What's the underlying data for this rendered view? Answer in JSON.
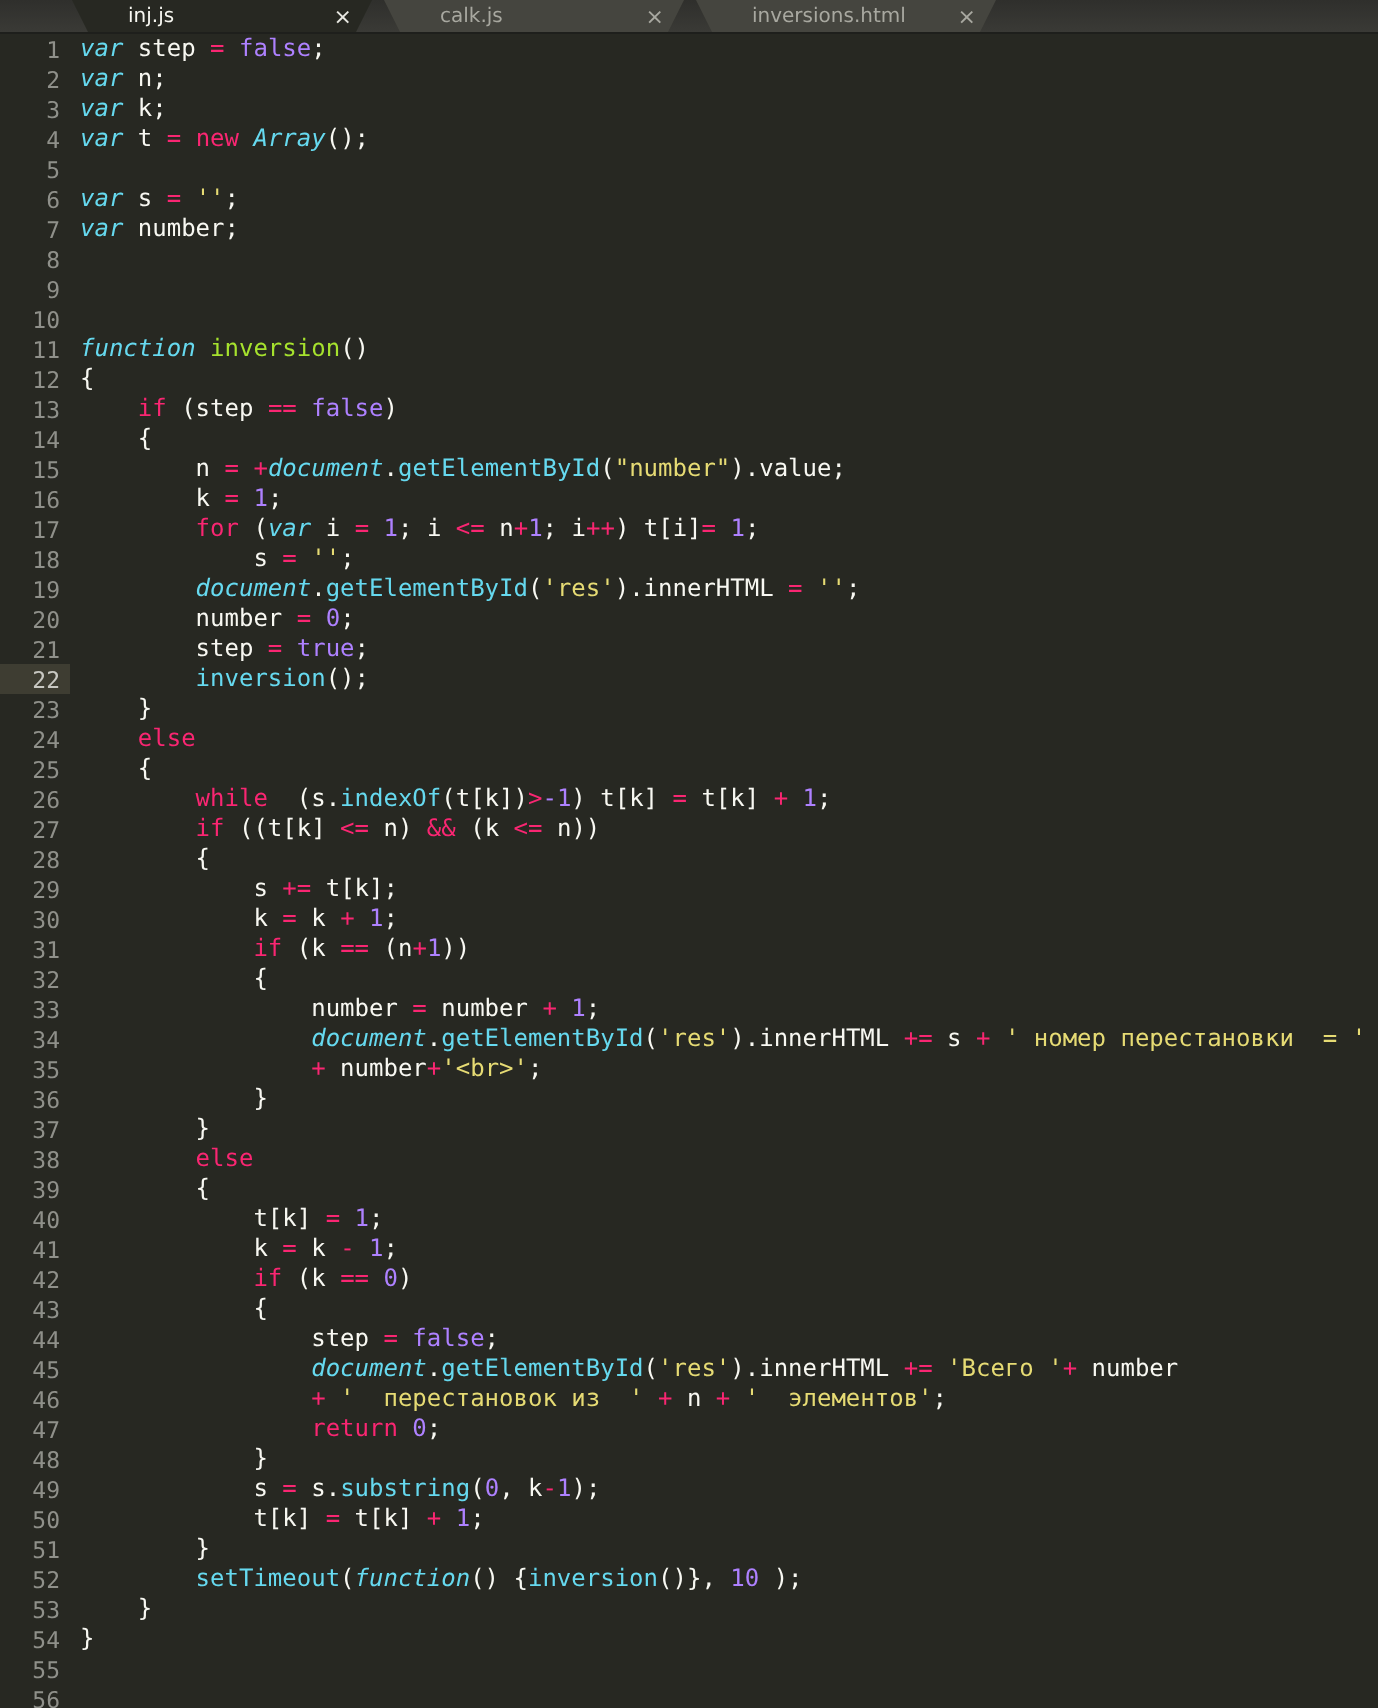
{
  "tabs": [
    {
      "label": "inj.js",
      "selected": true,
      "close": "×"
    },
    {
      "label": "calk.js",
      "selected": false,
      "close": "×"
    },
    {
      "label": "inversions.html",
      "selected": false,
      "close": "×"
    }
  ],
  "lines": [
    {
      "number": "1",
      "current": false,
      "tokens": [
        {
          "kind": "storage",
          "text": "var"
        },
        {
          "kind": "plain",
          "text": " step "
        },
        {
          "kind": "op",
          "text": "= "
        },
        {
          "kind": "const",
          "text": "false"
        },
        {
          "kind": "plain",
          "text": ";"
        }
      ]
    },
    {
      "number": "2",
      "current": false,
      "tokens": [
        {
          "kind": "storage",
          "text": "var"
        },
        {
          "kind": "plain",
          "text": " n;"
        }
      ]
    },
    {
      "number": "3",
      "current": false,
      "tokens": [
        {
          "kind": "storage",
          "text": "var"
        },
        {
          "kind": "plain",
          "text": " k;"
        }
      ]
    },
    {
      "number": "4",
      "current": false,
      "tokens": [
        {
          "kind": "storage",
          "text": "var"
        },
        {
          "kind": "plain",
          "text": " t "
        },
        {
          "kind": "op",
          "text": "= "
        },
        {
          "kind": "keyword",
          "text": "new "
        },
        {
          "kind": "storage",
          "text": "Array"
        },
        {
          "kind": "plain",
          "text": "();"
        }
      ]
    },
    {
      "number": "5",
      "current": false
    },
    {
      "number": "6",
      "current": false,
      "tokens": [
        {
          "kind": "storage",
          "text": "var"
        },
        {
          "kind": "plain",
          "text": " s "
        },
        {
          "kind": "op",
          "text": "= "
        },
        {
          "kind": "string",
          "text": "''"
        },
        {
          "kind": "plain",
          "text": ";"
        }
      ]
    },
    {
      "number": "7",
      "current": false,
      "tokens": [
        {
          "kind": "storage",
          "text": "var"
        },
        {
          "kind": "plain",
          "text": " number;"
        }
      ]
    },
    {
      "number": "8",
      "current": false
    },
    {
      "number": "9",
      "current": false
    },
    {
      "number": "10",
      "current": false
    },
    {
      "number": "11",
      "current": false,
      "tokens": [
        {
          "kind": "storage",
          "text": "function "
        },
        {
          "kind": "entity",
          "text": "inversion"
        },
        {
          "kind": "plain",
          "text": "()"
        }
      ]
    },
    {
      "number": "12",
      "current": false,
      "tokens": [
        {
          "kind": "plain",
          "text": "{"
        }
      ]
    },
    {
      "number": "13",
      "current": false,
      "tokens": [
        {
          "kind": "keyword",
          "text": "    if"
        },
        {
          "kind": "plain",
          "text": " (step "
        },
        {
          "kind": "op",
          "text": "== "
        },
        {
          "kind": "const",
          "text": "false"
        },
        {
          "kind": "plain",
          "text": ")"
        }
      ]
    },
    {
      "number": "14",
      "current": false,
      "tokens": [
        {
          "kind": "plain",
          "text": "    {"
        }
      ]
    },
    {
      "number": "15",
      "current": false,
      "tokens": [
        {
          "kind": "plain",
          "text": "        n "
        },
        {
          "kind": "op",
          "text": "= +"
        },
        {
          "kind": "storage",
          "text": "document"
        },
        {
          "kind": "plain",
          "text": "."
        },
        {
          "kind": "support",
          "text": "getElementById"
        },
        {
          "kind": "plain",
          "text": "("
        },
        {
          "kind": "string",
          "text": "\"number\""
        },
        {
          "kind": "plain",
          "text": ").value;"
        }
      ]
    },
    {
      "number": "16",
      "current": false,
      "tokens": [
        {
          "kind": "plain",
          "text": "        k "
        },
        {
          "kind": "op",
          "text": "= "
        },
        {
          "kind": "const",
          "text": "1"
        },
        {
          "kind": "plain",
          "text": ";"
        }
      ]
    },
    {
      "number": "17",
      "current": false,
      "tokens": [
        {
          "kind": "keyword",
          "text": "        for"
        },
        {
          "kind": "plain",
          "text": " ("
        },
        {
          "kind": "storage",
          "text": "var"
        },
        {
          "kind": "plain",
          "text": " i "
        },
        {
          "kind": "op",
          "text": "= "
        },
        {
          "kind": "const",
          "text": "1"
        },
        {
          "kind": "plain",
          "text": "; i "
        },
        {
          "kind": "op",
          "text": "<= "
        },
        {
          "kind": "plain",
          "text": "n"
        },
        {
          "kind": "op",
          "text": "+"
        },
        {
          "kind": "const",
          "text": "1"
        },
        {
          "kind": "plain",
          "text": "; i"
        },
        {
          "kind": "op",
          "text": "++"
        },
        {
          "kind": "plain",
          "text": ") t[i]"
        },
        {
          "kind": "op",
          "text": "= "
        },
        {
          "kind": "const",
          "text": "1"
        },
        {
          "kind": "plain",
          "text": ";"
        }
      ]
    },
    {
      "number": "18",
      "current": false,
      "tokens": [
        {
          "kind": "plain",
          "text": "            s "
        },
        {
          "kind": "op",
          "text": "= "
        },
        {
          "kind": "string",
          "text": "''"
        },
        {
          "kind": "plain",
          "text": ";"
        }
      ]
    },
    {
      "number": "19",
      "current": false,
      "tokens": [
        {
          "kind": "storage",
          "text": "        document"
        },
        {
          "kind": "plain",
          "text": "."
        },
        {
          "kind": "support",
          "text": "getElementById"
        },
        {
          "kind": "plain",
          "text": "("
        },
        {
          "kind": "string",
          "text": "'res'"
        },
        {
          "kind": "plain",
          "text": ").innerHTML "
        },
        {
          "kind": "op",
          "text": "= "
        },
        {
          "kind": "string",
          "text": "''"
        },
        {
          "kind": "plain",
          "text": ";"
        }
      ]
    },
    {
      "number": "20",
      "current": false,
      "tokens": [
        {
          "kind": "plain",
          "text": "        number "
        },
        {
          "kind": "op",
          "text": "= "
        },
        {
          "kind": "const",
          "text": "0"
        },
        {
          "kind": "plain",
          "text": ";"
        }
      ]
    },
    {
      "number": "21",
      "current": false,
      "tokens": [
        {
          "kind": "plain",
          "text": "        step "
        },
        {
          "kind": "op",
          "text": "= "
        },
        {
          "kind": "const",
          "text": "true"
        },
        {
          "kind": "plain",
          "text": ";"
        }
      ]
    },
    {
      "number": "22",
      "current": true,
      "tokens": [
        {
          "kind": "support",
          "text": "        inversion"
        },
        {
          "kind": "plain",
          "text": "();"
        }
      ]
    },
    {
      "number": "23",
      "current": false,
      "tokens": [
        {
          "kind": "plain",
          "text": "    }"
        }
      ]
    },
    {
      "number": "24",
      "current": false,
      "tokens": [
        {
          "kind": "keyword",
          "text": "    else"
        }
      ]
    },
    {
      "number": "25",
      "current": false,
      "tokens": [
        {
          "kind": "plain",
          "text": "    {"
        }
      ]
    },
    {
      "number": "26",
      "current": false,
      "tokens": [
        {
          "kind": "keyword",
          "text": "        while"
        },
        {
          "kind": "plain",
          "text": "  (s."
        },
        {
          "kind": "support",
          "text": "indexOf"
        },
        {
          "kind": "plain",
          "text": "(t[k])"
        },
        {
          "kind": "op",
          "text": ">"
        },
        {
          "kind": "const",
          "text": "-1"
        },
        {
          "kind": "plain",
          "text": ") t[k] "
        },
        {
          "kind": "op",
          "text": "= "
        },
        {
          "kind": "plain",
          "text": "t[k] "
        },
        {
          "kind": "op",
          "text": "+ "
        },
        {
          "kind": "const",
          "text": "1"
        },
        {
          "kind": "plain",
          "text": ";"
        }
      ]
    },
    {
      "number": "27",
      "current": false,
      "tokens": [
        {
          "kind": "keyword",
          "text": "        if"
        },
        {
          "kind": "plain",
          "text": " ((t[k] "
        },
        {
          "kind": "op",
          "text": "<= "
        },
        {
          "kind": "plain",
          "text": "n) "
        },
        {
          "kind": "op",
          "text": "&& "
        },
        {
          "kind": "plain",
          "text": "(k "
        },
        {
          "kind": "op",
          "text": "<= "
        },
        {
          "kind": "plain",
          "text": "n))"
        }
      ]
    },
    {
      "number": "28",
      "current": false,
      "tokens": [
        {
          "kind": "plain",
          "text": "        {"
        }
      ]
    },
    {
      "number": "29",
      "current": false,
      "tokens": [
        {
          "kind": "plain",
          "text": "            s "
        },
        {
          "kind": "op",
          "text": "+= "
        },
        {
          "kind": "plain",
          "text": "t[k];"
        }
      ]
    },
    {
      "number": "30",
      "current": false,
      "tokens": [
        {
          "kind": "plain",
          "text": "            k "
        },
        {
          "kind": "op",
          "text": "= "
        },
        {
          "kind": "plain",
          "text": "k "
        },
        {
          "kind": "op",
          "text": "+ "
        },
        {
          "kind": "const",
          "text": "1"
        },
        {
          "kind": "plain",
          "text": ";"
        }
      ]
    },
    {
      "number": "31",
      "current": false,
      "tokens": [
        {
          "kind": "keyword",
          "text": "            if"
        },
        {
          "kind": "plain",
          "text": " (k "
        },
        {
          "kind": "op",
          "text": "== "
        },
        {
          "kind": "plain",
          "text": "(n"
        },
        {
          "kind": "op",
          "text": "+"
        },
        {
          "kind": "const",
          "text": "1"
        },
        {
          "kind": "plain",
          "text": "))"
        }
      ]
    },
    {
      "number": "32",
      "current": false,
      "tokens": [
        {
          "kind": "plain",
          "text": "            {"
        }
      ]
    },
    {
      "number": "33",
      "current": false,
      "tokens": [
        {
          "kind": "plain",
          "text": "                number "
        },
        {
          "kind": "op",
          "text": "= "
        },
        {
          "kind": "plain",
          "text": "number "
        },
        {
          "kind": "op",
          "text": "+ "
        },
        {
          "kind": "const",
          "text": "1"
        },
        {
          "kind": "plain",
          "text": ";"
        }
      ]
    },
    {
      "number": "34",
      "current": false,
      "tokens": [
        {
          "kind": "storage",
          "text": "                document"
        },
        {
          "kind": "plain",
          "text": "."
        },
        {
          "kind": "support",
          "text": "getElementById"
        },
        {
          "kind": "plain",
          "text": "("
        },
        {
          "kind": "string",
          "text": "'res'"
        },
        {
          "kind": "plain",
          "text": ").innerHTML "
        },
        {
          "kind": "op",
          "text": "+= "
        },
        {
          "kind": "plain",
          "text": "s "
        },
        {
          "kind": "op",
          "text": "+ "
        },
        {
          "kind": "string",
          "text": "' номер перестановки  = '"
        }
      ]
    },
    {
      "number": "35",
      "current": false,
      "tokens": [
        {
          "kind": "op",
          "text": "                +"
        },
        {
          "kind": "plain",
          "text": " number"
        },
        {
          "kind": "op",
          "text": "+"
        },
        {
          "kind": "string",
          "text": "'<br>'"
        },
        {
          "kind": "plain",
          "text": ";"
        }
      ]
    },
    {
      "number": "36",
      "current": false,
      "tokens": [
        {
          "kind": "plain",
          "text": "            }"
        }
      ]
    },
    {
      "number": "37",
      "current": false,
      "tokens": [
        {
          "kind": "plain",
          "text": "        }"
        }
      ]
    },
    {
      "number": "38",
      "current": false,
      "tokens": [
        {
          "kind": "keyword",
          "text": "        else"
        }
      ]
    },
    {
      "number": "39",
      "current": false,
      "tokens": [
        {
          "kind": "plain",
          "text": "        {"
        }
      ]
    },
    {
      "number": "40",
      "current": false,
      "tokens": [
        {
          "kind": "plain",
          "text": "            t[k] "
        },
        {
          "kind": "op",
          "text": "= "
        },
        {
          "kind": "const",
          "text": "1"
        },
        {
          "kind": "plain",
          "text": ";"
        }
      ]
    },
    {
      "number": "41",
      "current": false,
      "tokens": [
        {
          "kind": "plain",
          "text": "            k "
        },
        {
          "kind": "op",
          "text": "= "
        },
        {
          "kind": "plain",
          "text": "k "
        },
        {
          "kind": "op",
          "text": "- "
        },
        {
          "kind": "const",
          "text": "1"
        },
        {
          "kind": "plain",
          "text": ";"
        }
      ]
    },
    {
      "number": "42",
      "current": false,
      "tokens": [
        {
          "kind": "keyword",
          "text": "            if"
        },
        {
          "kind": "plain",
          "text": " (k "
        },
        {
          "kind": "op",
          "text": "== "
        },
        {
          "kind": "const",
          "text": "0"
        },
        {
          "kind": "plain",
          "text": ")"
        }
      ]
    },
    {
      "number": "43",
      "current": false,
      "tokens": [
        {
          "kind": "plain",
          "text": "            {"
        }
      ]
    },
    {
      "number": "44",
      "current": false,
      "tokens": [
        {
          "kind": "plain",
          "text": "                step "
        },
        {
          "kind": "op",
          "text": "= "
        },
        {
          "kind": "const",
          "text": "false"
        },
        {
          "kind": "plain",
          "text": ";"
        }
      ]
    },
    {
      "number": "45",
      "current": false,
      "tokens": [
        {
          "kind": "storage",
          "text": "                document"
        },
        {
          "kind": "plain",
          "text": "."
        },
        {
          "kind": "support",
          "text": "getElementById"
        },
        {
          "kind": "plain",
          "text": "("
        },
        {
          "kind": "string",
          "text": "'res'"
        },
        {
          "kind": "plain",
          "text": ").innerHTML "
        },
        {
          "kind": "op",
          "text": "+= "
        },
        {
          "kind": "string",
          "text": "'Всего '"
        },
        {
          "kind": "op",
          "text": "+"
        },
        {
          "kind": "plain",
          "text": " number"
        }
      ]
    },
    {
      "number": "46",
      "current": false,
      "tokens": [
        {
          "kind": "op",
          "text": "                + "
        },
        {
          "kind": "string",
          "text": "'  перестановок из  '"
        },
        {
          "kind": "op",
          "text": " + "
        },
        {
          "kind": "plain",
          "text": "n "
        },
        {
          "kind": "op",
          "text": "+ "
        },
        {
          "kind": "string",
          "text": "'  элементов'"
        },
        {
          "kind": "plain",
          "text": ";"
        }
      ]
    },
    {
      "number": "47",
      "current": false,
      "tokens": [
        {
          "kind": "keyword",
          "text": "                return "
        },
        {
          "kind": "const",
          "text": "0"
        },
        {
          "kind": "plain",
          "text": ";"
        }
      ]
    },
    {
      "number": "48",
      "current": false,
      "tokens": [
        {
          "kind": "plain",
          "text": "            }"
        }
      ]
    },
    {
      "number": "49",
      "current": false,
      "tokens": [
        {
          "kind": "plain",
          "text": "            s "
        },
        {
          "kind": "op",
          "text": "= "
        },
        {
          "kind": "plain",
          "text": "s."
        },
        {
          "kind": "support",
          "text": "substring"
        },
        {
          "kind": "plain",
          "text": "("
        },
        {
          "kind": "const",
          "text": "0"
        },
        {
          "kind": "plain",
          "text": ", k"
        },
        {
          "kind": "op",
          "text": "-"
        },
        {
          "kind": "const",
          "text": "1"
        },
        {
          "kind": "plain",
          "text": ");"
        }
      ]
    },
    {
      "number": "50",
      "current": false,
      "tokens": [
        {
          "kind": "plain",
          "text": "            t[k] "
        },
        {
          "kind": "op",
          "text": "= "
        },
        {
          "kind": "plain",
          "text": "t[k] "
        },
        {
          "kind": "op",
          "text": "+ "
        },
        {
          "kind": "const",
          "text": "1"
        },
        {
          "kind": "plain",
          "text": ";"
        }
      ]
    },
    {
      "number": "51",
      "current": false,
      "tokens": [
        {
          "kind": "plain",
          "text": "        }"
        }
      ]
    },
    {
      "number": "52",
      "current": false,
      "tokens": [
        {
          "kind": "support",
          "text": "        setTimeout"
        },
        {
          "kind": "plain",
          "text": "("
        },
        {
          "kind": "storage",
          "text": "function"
        },
        {
          "kind": "plain",
          "text": "() {"
        },
        {
          "kind": "support",
          "text": "inversion"
        },
        {
          "kind": "plain",
          "text": "()}, "
        },
        {
          "kind": "const",
          "text": "10"
        },
        {
          "kind": "plain",
          "text": " );"
        }
      ]
    },
    {
      "number": "53",
      "current": false,
      "tokens": [
        {
          "kind": "plain",
          "text": "    }"
        }
      ]
    },
    {
      "number": "54",
      "current": false,
      "tokens": [
        {
          "kind": "plain",
          "text": "}"
        }
      ]
    },
    {
      "number": "55",
      "current": false
    },
    {
      "number": "56",
      "current": false
    }
  ]
}
